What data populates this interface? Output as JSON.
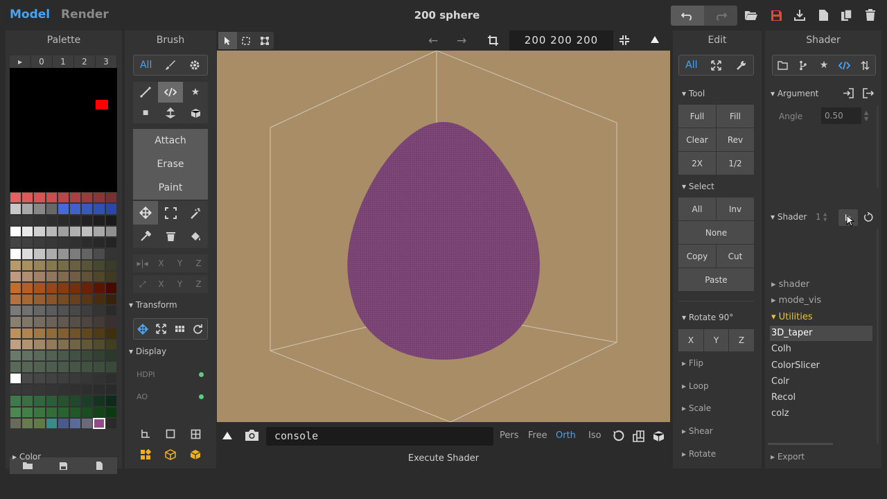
{
  "topbar": {
    "mode_model": "Model",
    "mode_render": "Render",
    "title": "200 sphere",
    "icons": [
      "undo-icon",
      "redo-icon",
      "open-folder-icon",
      "save-icon",
      "download-icon",
      "new-file-icon",
      "duplicate-icon",
      "trash-icon"
    ]
  },
  "palette": {
    "title": "Palette",
    "tabs": [
      "▸",
      "0",
      "1",
      "2",
      "3"
    ],
    "section_color": "Color",
    "selected_color": "#8e4d88",
    "swatches": [
      "#e46161",
      "#dc5a5a",
      "#d45555",
      "#c84f4f",
      "#b84848",
      "#a84242",
      "#983c3c",
      "#883636",
      "#783030",
      "#c8c8c8",
      "#a8a8a8",
      "#888888",
      "#686868",
      "#4a68d8",
      "#4260cc",
      "#3a58c0",
      "#3250b4",
      "#2a48a8",
      "#3a3a3a",
      "#363636",
      "#323232",
      "#2e2e2e",
      "#2a2a2a",
      "#262626",
      "#222222",
      "#1e1e1e",
      "#1a1a1a",
      "#ffffff",
      "#e8e8e8",
      "#d0d0d0",
      "#b8b8b8",
      "#a0a0a0",
      "#b0b0b0",
      "#c0c0c0",
      "#a8a8a8",
      "#909090",
      "#444444",
      "#404040",
      "#3c3c3c",
      "#383838",
      "#343434",
      "#303030",
      "#2c2c2c",
      "#282828",
      "#242424",
      "#ffffff",
      "#dcdcdc",
      "#c4c4c4",
      "#acacac",
      "#949494",
      "#7c7c7c",
      "#646464",
      "#4c4c4c",
      "#343434",
      "#b89a68",
      "#a89060",
      "#988458",
      "#887850",
      "#786c48",
      "#686040",
      "#585438",
      "#484830",
      "#383c28",
      "#c09a80",
      "#b08e74",
      "#a08268",
      "#90765c",
      "#806a50",
      "#705e44",
      "#605238",
      "#50462c",
      "#403a20",
      "#c86a2a",
      "#b85e24",
      "#a8521e",
      "#984618",
      "#883a12",
      "#782e0c",
      "#682206",
      "#581600",
      "#480a00",
      "#b8713a",
      "#a86834",
      "#985e2e",
      "#885428",
      "#784a22",
      "#68401c",
      "#583616",
      "#482c10",
      "#38220a",
      "#7a7a7a",
      "#707070",
      "#666666",
      "#5c5c5c",
      "#525252",
      "#484848",
      "#3e3e3e",
      "#343434",
      "#2a2a2a",
      "#8a8070",
      "#807668",
      "#766c60",
      "#6c6258",
      "#625850",
      "#584e48",
      "#4e4440",
      "#443a38",
      "#3a3030",
      "#c0905a",
      "#b08450",
      "#a07846",
      "#906c3c",
      "#806032",
      "#705428",
      "#60481e",
      "#503c14",
      "#40300a",
      "#c0a080",
      "#b09474",
      "#a08868",
      "#907c5c",
      "#807050",
      "#706444",
      "#605838",
      "#504c2c",
      "#404020",
      "#6a7a6a",
      "#627262",
      "#5a6a5a",
      "#526252",
      "#4a5a4a",
      "#425242",
      "#3a4a3a",
      "#324232",
      "#2a3a2a",
      "#5a6a5a",
      "#566656",
      "#526252",
      "#4e5e4e",
      "#4a5a4a",
      "#465646",
      "#425242",
      "#3e4e3e",
      "#3a4a3a",
      "#ffffff",
      "#4a4a4a",
      "#464646",
      "#424242",
      "#3e3e3e",
      "#3a3a3a",
      "#363636",
      "#323232",
      "#2e2e2e",
      "#3a3a3a",
      "#383838",
      "#363636",
      "#343434",
      "#323232",
      "#303030",
      "#2e2e2e",
      "#2c2c2c",
      "#2a2a2a",
      "#3e7a4a",
      "#387044",
      "#32663e",
      "#2c5c38",
      "#265232",
      "#20482c",
      "#1a3e26",
      "#143420",
      "#0e2a1a",
      "#4a8a50",
      "#428048",
      "#3a7640",
      "#326c38",
      "#2a6230",
      "#225828",
      "#1a4e20",
      "#124418",
      "#0a3a10",
      "#6a6a5a",
      "#6a7a50",
      "#627a48",
      "#3a8a8a",
      "#4a5a8a",
      "#5a6a9a",
      "#6a6a7a",
      "#8e4d88",
      "#2a2a2a"
    ]
  },
  "brush": {
    "title": "Brush",
    "seg_all": "All",
    "attach": "Attach",
    "erase": "Erase",
    "paint": "Paint",
    "axis_x": "X",
    "axis_y": "Y",
    "axis_z": "Z",
    "transform": "Transform",
    "display": "Display",
    "hdpi": "HDPI",
    "ao": "AO"
  },
  "viewport": {
    "dims": "200  200  200",
    "console": "console",
    "modes": [
      "Pers",
      "Free",
      "Orth",
      "Iso"
    ],
    "active_mode": "Orth",
    "execute": "Execute Shader",
    "background": "#a98d66",
    "object_color": "#7b4476"
  },
  "edit": {
    "title": "Edit",
    "seg_all": "All",
    "tool": "Tool",
    "full": "Full",
    "fill": "Fill",
    "clear": "Clear",
    "rev": "Rev",
    "two_x": "2X",
    "half": "1/2",
    "select": "Select",
    "sel_all": "All",
    "inv": "Inv",
    "none": "None",
    "copy": "Copy",
    "cut": "Cut",
    "paste": "Paste",
    "rotate90": "Rotate 90°",
    "rx": "X",
    "ry": "Y",
    "rz": "Z",
    "flip": "Flip",
    "loop": "Loop",
    "scale": "Scale",
    "shear": "Shear",
    "rotate": "Rotate"
  },
  "shader": {
    "title": "Shader",
    "argument": "Argument",
    "angle_label": "Angle",
    "angle_value": "0.50",
    "shader_label": "Shader",
    "shader_count": "1",
    "items": [
      {
        "label": "shader",
        "kind": "folder"
      },
      {
        "label": "mode_vis",
        "kind": "folder"
      },
      {
        "label": "Utilities",
        "kind": "open"
      },
      {
        "label": "3D_taper",
        "kind": "selected"
      },
      {
        "label": "Colh",
        "kind": "item"
      },
      {
        "label": "ColorSlicer",
        "kind": "item"
      },
      {
        "label": "Colr",
        "kind": "item"
      },
      {
        "label": "Recol",
        "kind": "item"
      },
      {
        "label": "colz",
        "kind": "item"
      }
    ],
    "export": "Export"
  },
  "colors": {
    "accent": "#4aa3f0",
    "folder_open": "#f0c23a"
  }
}
